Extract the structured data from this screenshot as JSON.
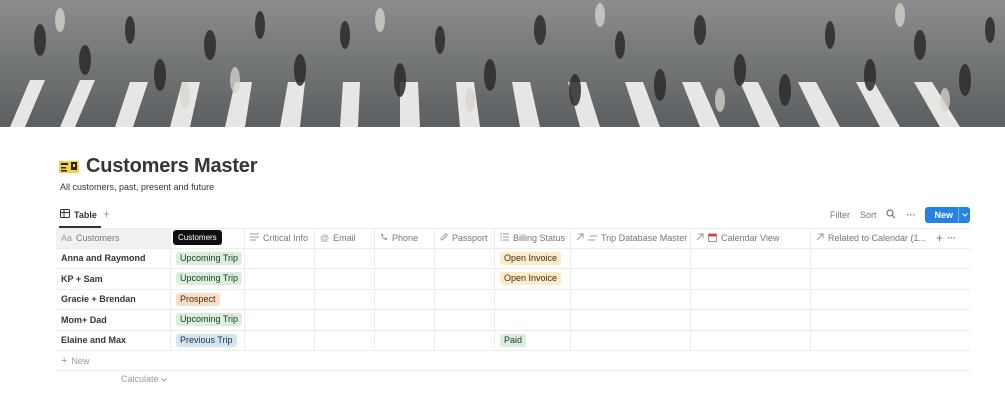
{
  "page": {
    "title": "Customers Master",
    "description": "All customers, past, present and future"
  },
  "view": {
    "tab_label": "Table",
    "add_view": "+",
    "filter": "Filter",
    "sort": "Sort",
    "more": "···",
    "new_label": "New"
  },
  "table": {
    "tooltip": "Customers",
    "headers": {
      "name": "Customers",
      "critical": "Critical Info",
      "email": "Email",
      "phone": "Phone",
      "passport": "Passport",
      "billing": "Billing Status",
      "trip_db": "Trip Database Master",
      "calendar": "Calendar View",
      "related": "Related to Calendar (1...",
      "add": "+",
      "more": "···"
    },
    "rows": [
      {
        "name": "Anna and Raymond",
        "customers": "Upcoming Trip",
        "billing": "Open Invoice"
      },
      {
        "name": "KP + Sam",
        "customers": "Upcoming Trip",
        "billing": "Open Invoice"
      },
      {
        "name": "Gracie + Brendan",
        "customers": "Prospect",
        "billing": ""
      },
      {
        "name": "Mom+ Dad",
        "customers": "Upcoming Trip",
        "billing": ""
      },
      {
        "name": "Elaine and Max",
        "customers": "Previous Trip",
        "billing": "Paid"
      }
    ],
    "new_row": "New",
    "calculate": "Calculate"
  },
  "colors": {
    "upcoming_bg": "#dbeddb",
    "upcoming_fg": "#1c3829",
    "prospect_bg": "#fadec9",
    "prospect_fg": "#49290e",
    "previous_bg": "#d3e5ef",
    "previous_fg": "#183347",
    "invoice_bg": "#fdecc8",
    "invoice_fg": "#402c1b",
    "paid_bg": "#dbeddb",
    "paid_fg": "#1c3829",
    "accent": "#2383e2"
  },
  "icons": [
    "table-icon",
    "text-icon",
    "at-icon",
    "phone-icon",
    "paperclip-icon",
    "list-icon",
    "relation-arrow-icon",
    "calendar-icon",
    "search-icon",
    "plus-icon"
  ]
}
